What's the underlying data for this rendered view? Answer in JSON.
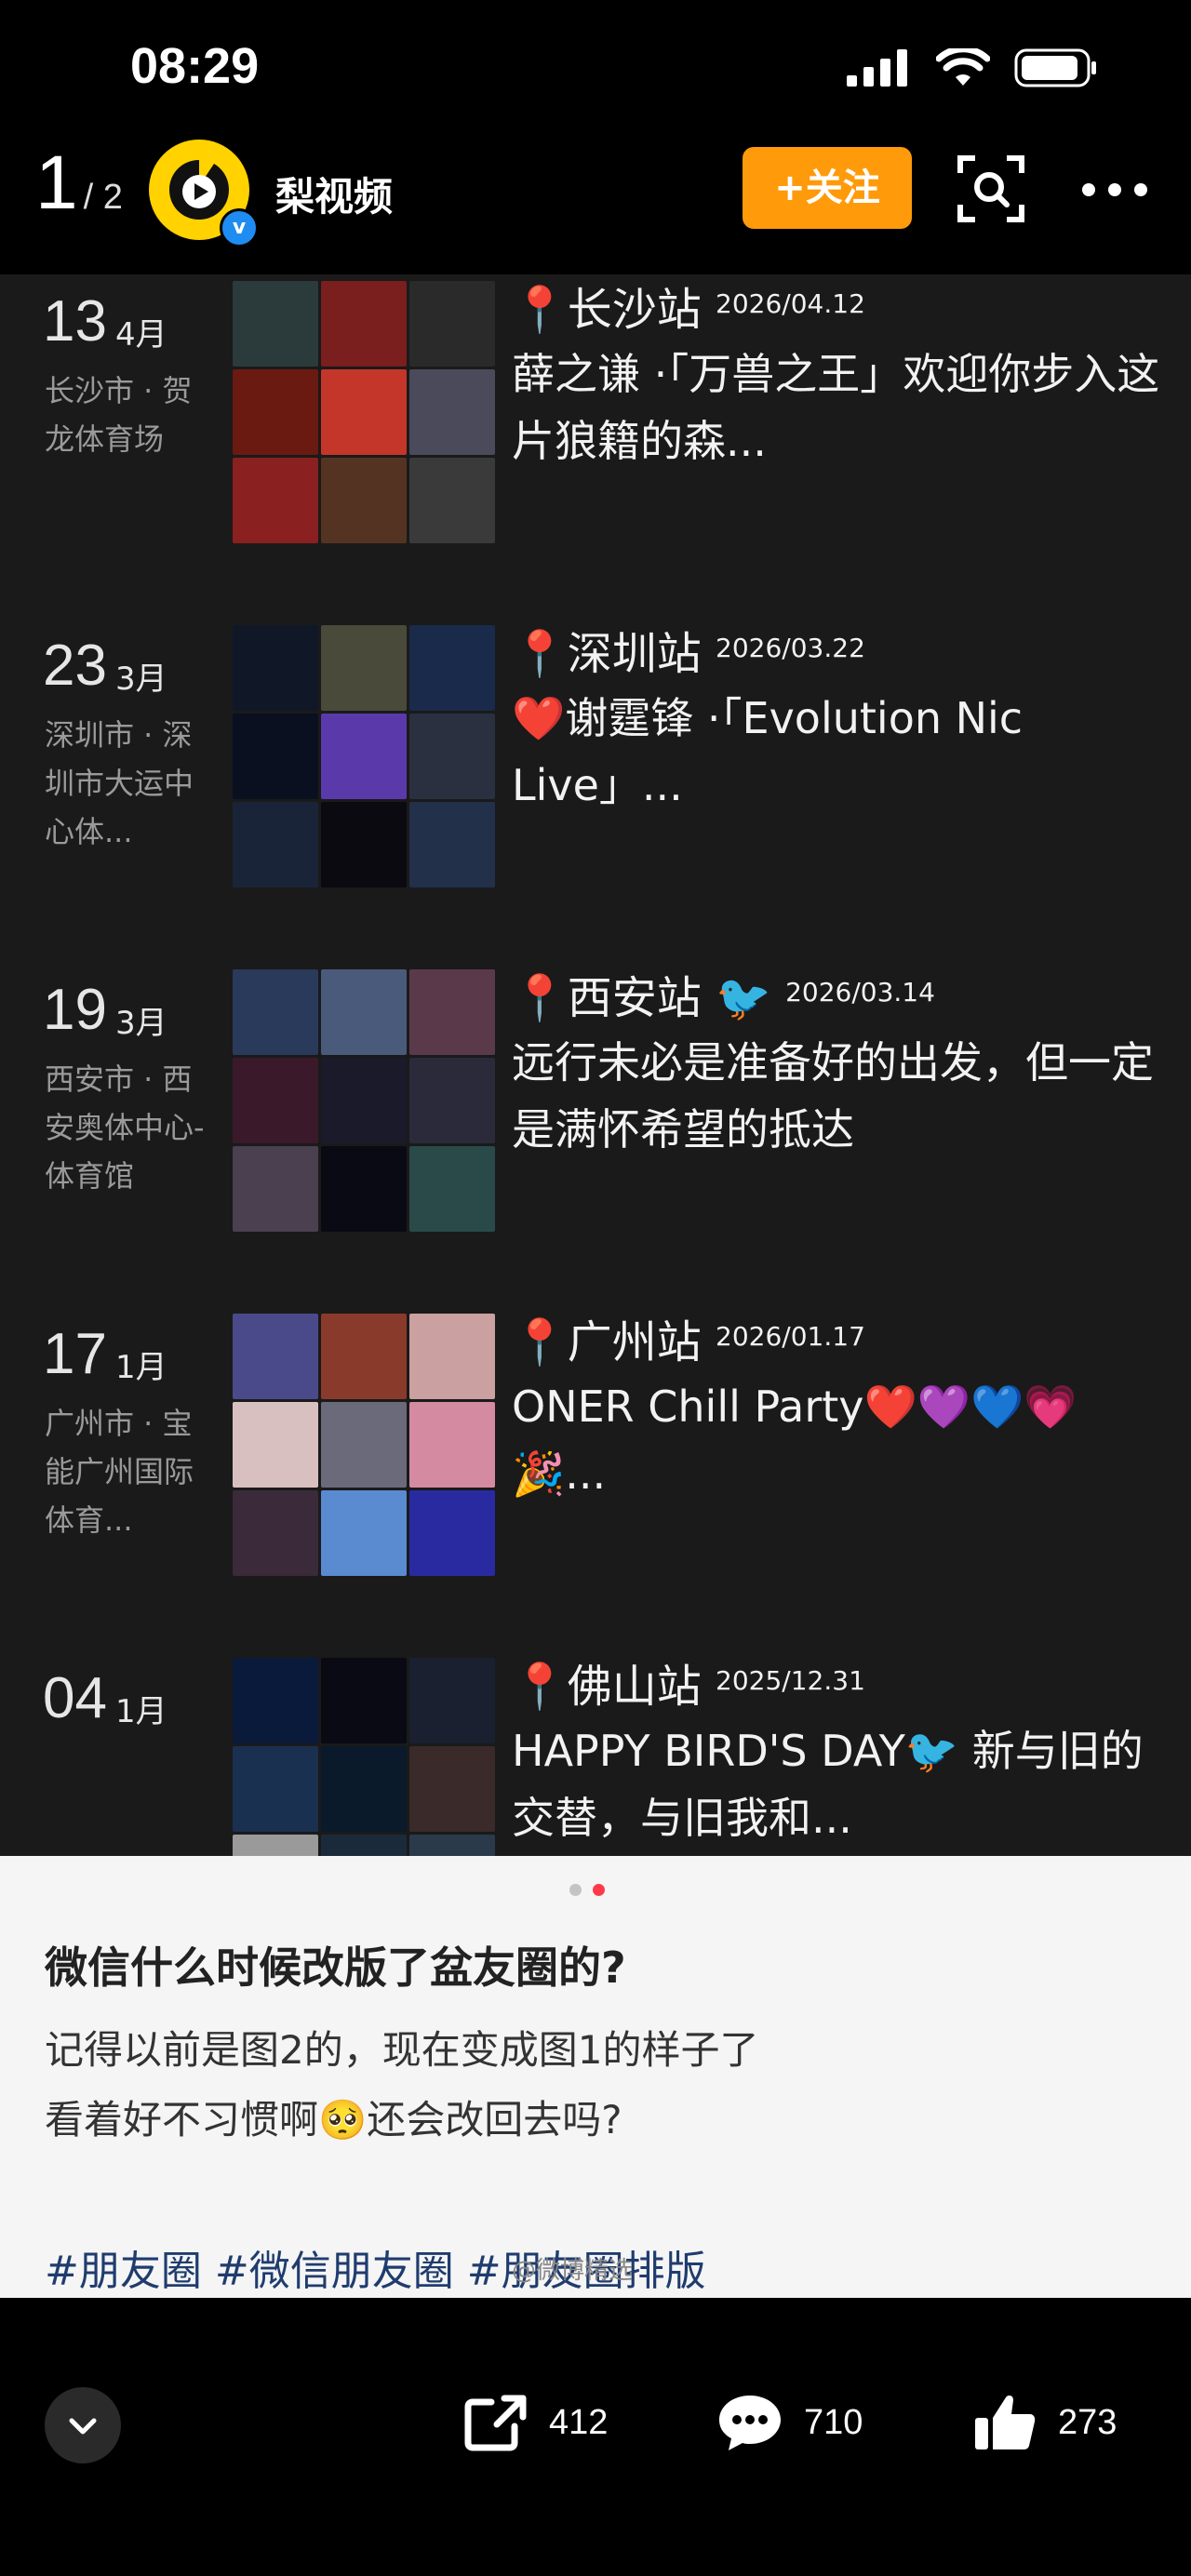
{
  "status_bar": {
    "time": "08:29"
  },
  "header": {
    "page_current": "1",
    "page_total": "/ 2",
    "channel_name": "梨视频",
    "follow_label": "+关注",
    "verified_mark": "v"
  },
  "posts": [
    {
      "day": "13",
      "month": "4月",
      "location": "长沙市 · 贺龙体育场",
      "title": "📍长沙站",
      "date_badge": "2026/04.12",
      "text": "薛之谦 ·「万兽之王」欢迎你步入这片狼籍的森...",
      "tiles": [
        "#2b3a3a",
        "#7a1e1e",
        "#2a2a2a",
        "#6a1a10",
        "#c4362a",
        "#4a4a5a",
        "#8a2020",
        "#553322",
        "#3a3a3a"
      ]
    },
    {
      "day": "23",
      "month": "3月",
      "location": "深圳市 · 深圳市大运中心体...",
      "title": "📍深圳站",
      "date_badge": "2026/03.22",
      "text": "❤️谢霆锋 ·「Evolution Nic Live」...",
      "tiles": [
        "#101828",
        "#4a4a3a",
        "#1a2a4a",
        "#0a1020",
        "#5a3aaa",
        "#2a3040",
        "#1a2438",
        "#0a0a10",
        "#22304a"
      ]
    },
    {
      "day": "19",
      "month": "3月",
      "location": "西安市 · 西安奥体中心-体育馆",
      "title": "📍西安站 🐦",
      "date_badge": "2026/03.14",
      "text": "远行未必是准备好的出发，但一定是满怀希望的抵达",
      "tiles": [
        "#2a3a5a",
        "#4a5a7a",
        "#5a3a4a",
        "#3a1a2a",
        "#1a1a2a",
        "#2a2a3a",
        "#4a4050",
        "#0a0a14",
        "#2a4a4a"
      ]
    },
    {
      "day": "17",
      "month": "1月",
      "location": "广州市 · 宝能广州国际体育...",
      "title": "📍广州站",
      "date_badge": "2026/01.17",
      "text": "ONER Chill Party❤️💜💙💗🎉...",
      "tiles": [
        "#4a4a8a",
        "#8a3a2a",
        "#caa0a0",
        "#d8c0c0",
        "#6a6a7a",
        "#d48aa0",
        "#3a2a3a",
        "#5a8ad0",
        "#2a2aa0"
      ]
    },
    {
      "day": "04",
      "month": "1月",
      "location": "",
      "title": "📍佛山站",
      "date_badge": "2025/12.31",
      "text": "HAPPY BIRD'S DAY🐦 新与旧的交替，与旧我和...",
      "tiles": [
        "#0a1a3a",
        "#0a0a14",
        "#1a2030",
        "#1a3050",
        "#0a1a2a",
        "#3a2a2a",
        "#9a9a9a",
        "#1a2a3a",
        "#2a3a4a"
      ]
    }
  ],
  "card": {
    "title": "微信什么时候改版了盆友圈的?",
    "line1": "记得以前是图2的，现在变成图1的样子了",
    "line2": "看着好不习惯啊🥺还会改回去吗?",
    "tags": "#朋友圈 #微信朋友圈 #朋友圈排版",
    "watermark": "@微博精选"
  },
  "actions": {
    "share_count": "412",
    "comment_count": "710",
    "like_count": "273"
  },
  "colors": {
    "accent": "#ff9a0a",
    "verified": "#1e8cf0",
    "card_bg": "#f5f5f5",
    "feed_bg": "#1a1a1a"
  }
}
